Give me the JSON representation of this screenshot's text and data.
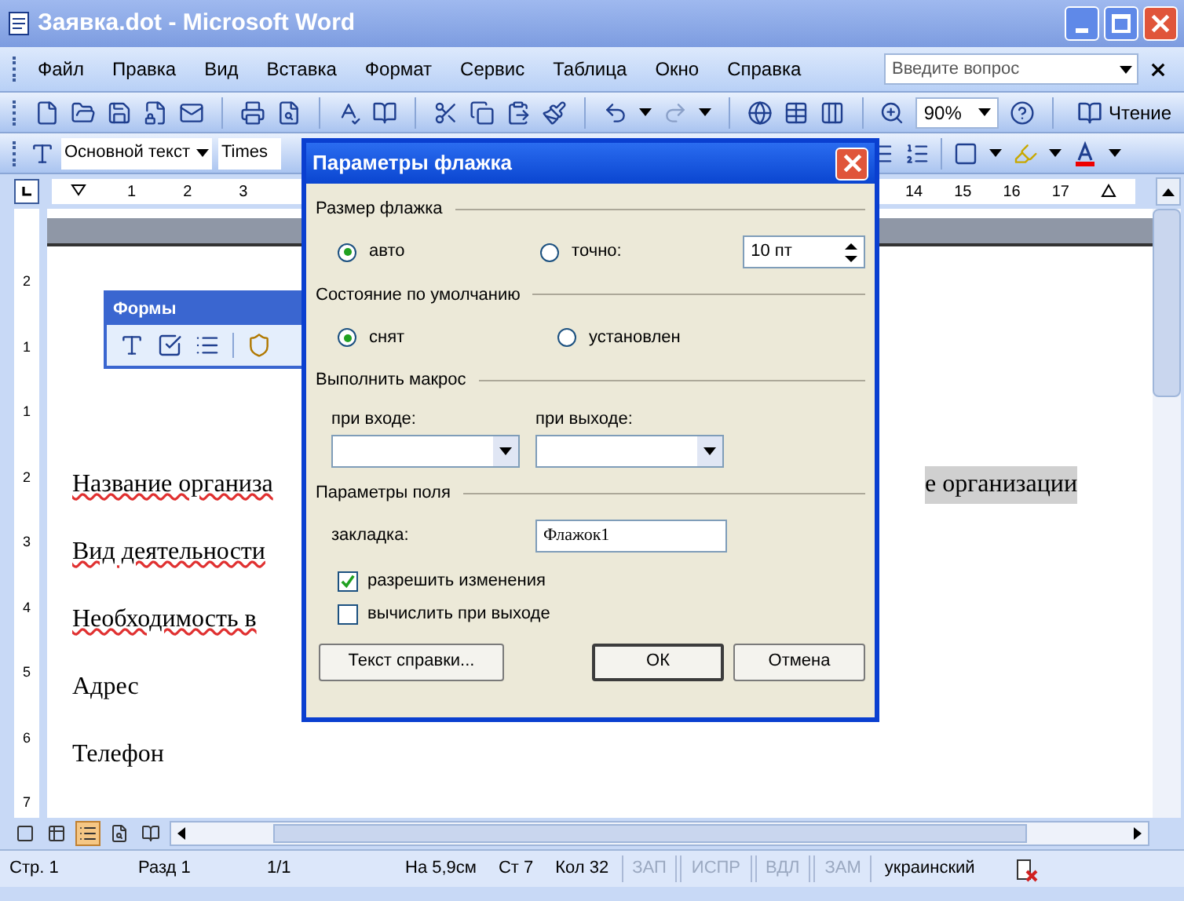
{
  "window": {
    "title": "Заявка.dot - Microsoft Word"
  },
  "menu": [
    {
      "label": "Файл"
    },
    {
      "label": "Правка"
    },
    {
      "label": "Вид"
    },
    {
      "label": "Вставка"
    },
    {
      "label": "Формат"
    },
    {
      "label": "Сервис"
    },
    {
      "label": "Таблица"
    },
    {
      "label": "Окно"
    },
    {
      "label": "Справка"
    }
  ],
  "help_box": {
    "placeholder": "Введите вопрос"
  },
  "standard_toolbar": {
    "zoom": "90%",
    "reading_button": "Чтение"
  },
  "format_toolbar": {
    "style": "Основной текст",
    "font": "Times"
  },
  "ruler": {
    "left_marks": [
      "1",
      "2",
      "3"
    ],
    "right_marks": [
      "14",
      "15",
      "16",
      "17"
    ],
    "vertical_marks": [
      "2",
      "1",
      "1",
      "2",
      "3",
      "4",
      "5",
      "6",
      "7"
    ]
  },
  "forms_toolbar": {
    "title": "Формы"
  },
  "document": {
    "paragraphs": [
      {
        "text": "Название организа",
        "spell_error": true,
        "field_text": "е организации"
      },
      {
        "text": "Вид деятельности",
        "spell_error": true
      },
      {
        "text": "Необходимость в",
        "spell_error": true
      },
      {
        "text": "Адрес",
        "spell_error": false
      },
      {
        "text": "Телефон",
        "spell_error": false
      }
    ]
  },
  "dialog": {
    "title": "Параметры флажка",
    "sections": [
      {
        "kind": "radios",
        "title": "Размер флажка",
        "options": [
          {
            "label": "авто",
            "selected": true
          },
          {
            "label": "точно:",
            "selected": false
          }
        ],
        "spin_value": "10 пт"
      },
      {
        "kind": "radios",
        "title": "Состояние по умолчанию",
        "options": [
          {
            "label": "снят",
            "selected": true
          },
          {
            "label": "установлен",
            "selected": false
          }
        ]
      },
      {
        "kind": "macros",
        "title": "Выполнить макрос",
        "fields": [
          {
            "label": "при входе:"
          },
          {
            "label": "при выходе:"
          }
        ]
      },
      {
        "kind": "field",
        "title": "Параметры поля",
        "label": "закладка:",
        "value": "Флажок1",
        "checks": [
          {
            "label": "разрешить изменения",
            "checked": true
          },
          {
            "label": "вычислить при выходе",
            "checked": false
          }
        ]
      }
    ],
    "buttons": [
      {
        "label": "Текст справки...",
        "default": false
      },
      {
        "label": "ОК",
        "default": true
      },
      {
        "label": "Отмена",
        "default": false
      }
    ]
  },
  "status_bar": [
    {
      "text": "Стр. 1",
      "disabled": false
    },
    {
      "text": "Разд 1",
      "disabled": false
    },
    {
      "text": "1/1",
      "disabled": false
    },
    {
      "text": "На 5,9см",
      "disabled": false
    },
    {
      "text": "Ст 7",
      "disabled": false
    },
    {
      "text": "Кол 32",
      "disabled": false
    },
    {
      "text": "ЗАП",
      "disabled": true
    },
    {
      "text": "ИСПР",
      "disabled": true
    },
    {
      "text": "ВДЛ",
      "disabled": true
    },
    {
      "text": "ЗАМ",
      "disabled": true
    },
    {
      "text": "украинский",
      "disabled": false
    }
  ]
}
